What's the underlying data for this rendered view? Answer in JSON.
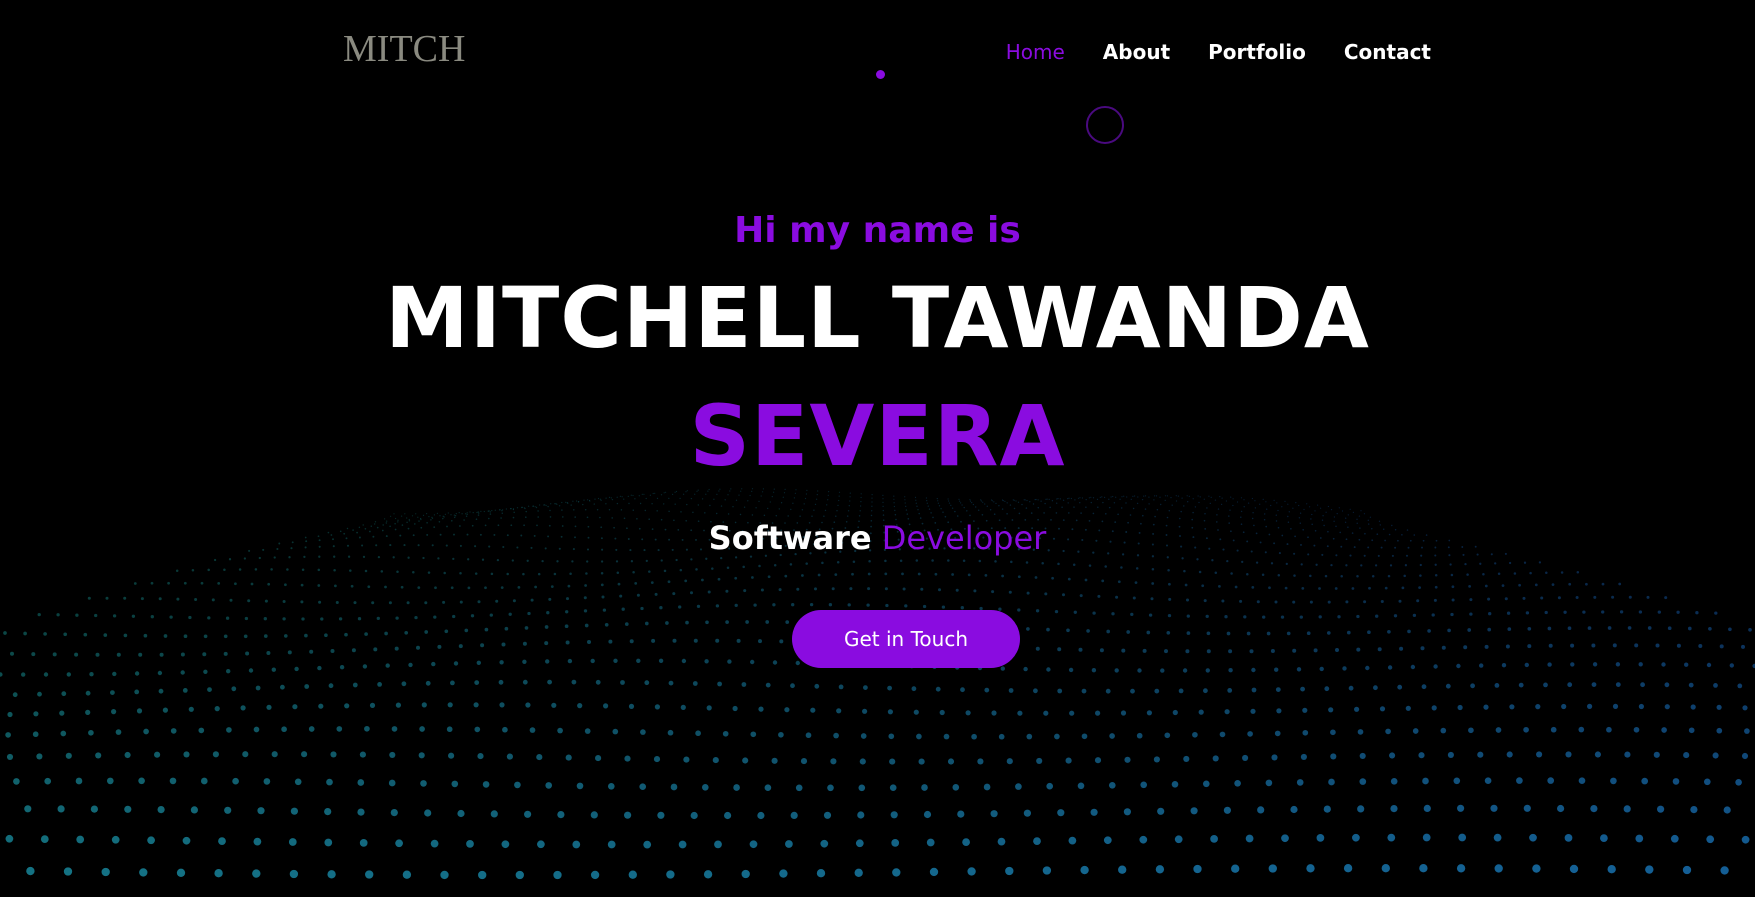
{
  "nav": {
    "logo": "MITCH",
    "links": [
      {
        "label": "Home",
        "active": true
      },
      {
        "label": "About",
        "active": false
      },
      {
        "label": "Portfolio",
        "active": false
      },
      {
        "label": "Contact",
        "active": false
      }
    ]
  },
  "hero": {
    "greeting": "Hi my name is",
    "name_line1": "MITCHELL TAWANDA",
    "name_line2": "SEVERA",
    "role_word1": "Software",
    "role_word2": "Developer",
    "cta_label": "Get in Touch"
  },
  "colors": {
    "accent": "#8a0ce0",
    "background": "#000000",
    "dot_teal": "#1aa3a0",
    "dot_blue": "#1a6fd0"
  }
}
